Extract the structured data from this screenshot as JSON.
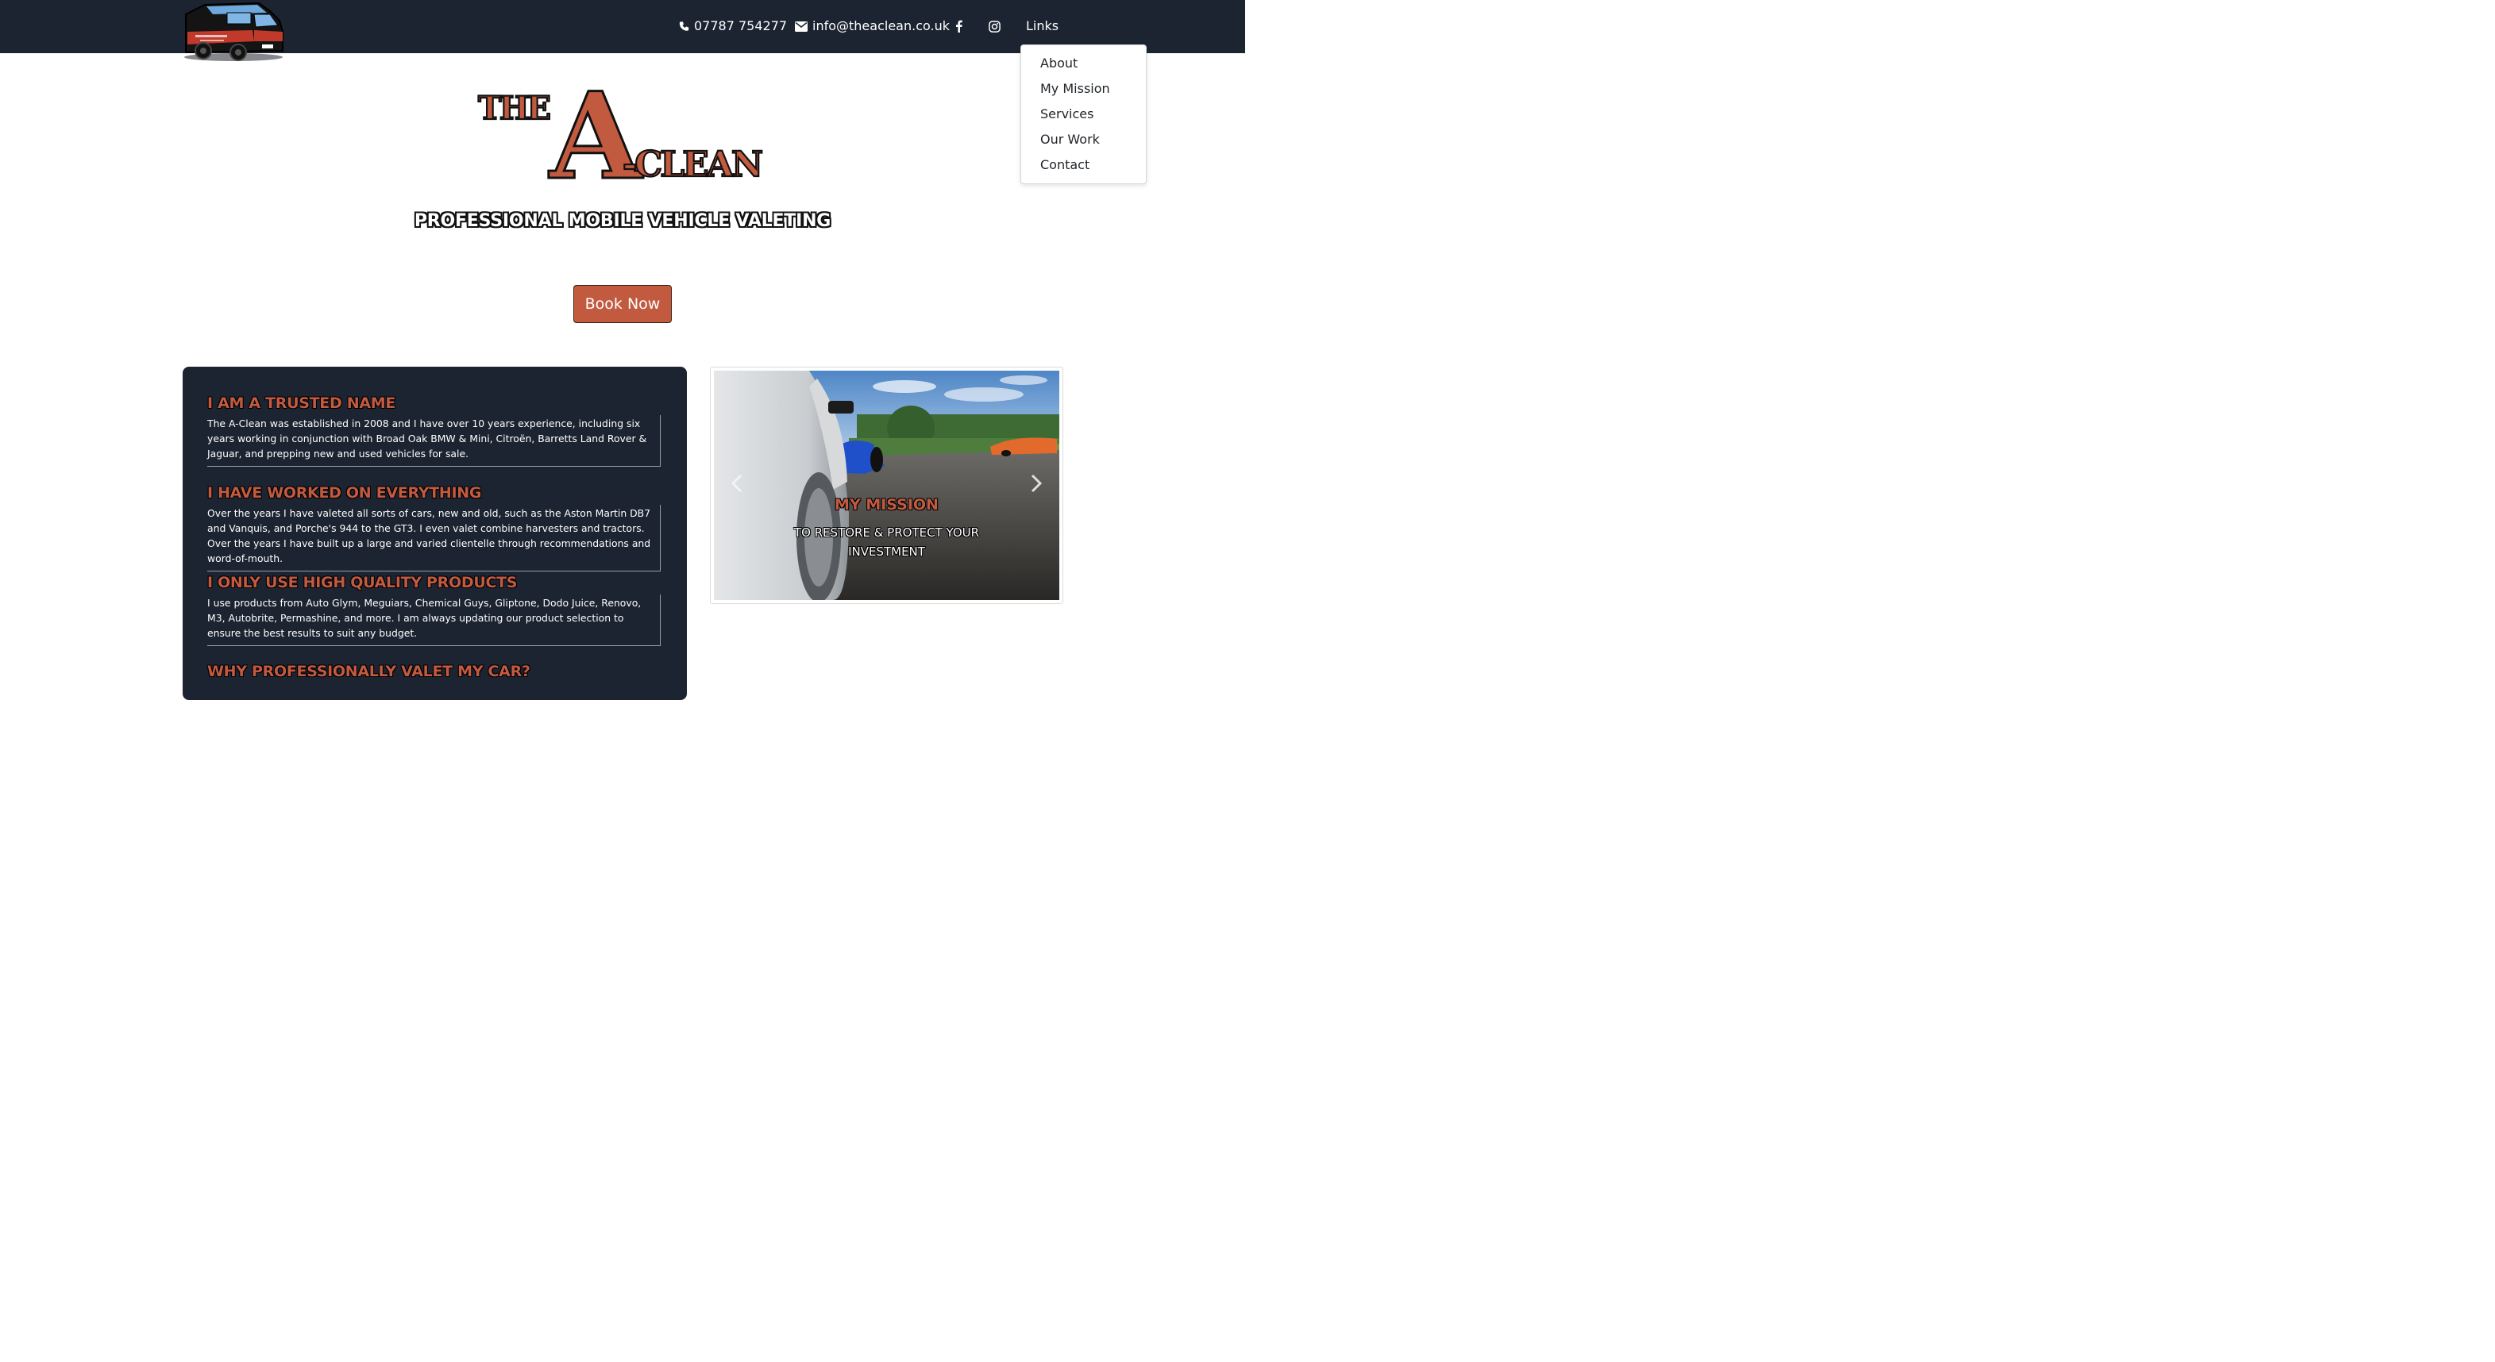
{
  "nav": {
    "phone": "07787 754277",
    "email": "info@theaclean.co.uk",
    "links_label": "Links",
    "icons": {
      "phone": "phone-icon",
      "email": "envelope-icon",
      "facebook": "facebook-icon",
      "instagram": "instagram-icon"
    }
  },
  "dropdown": {
    "items": [
      {
        "label": "About"
      },
      {
        "label": "My Mission"
      },
      {
        "label": "Services"
      },
      {
        "label": "Our Work"
      },
      {
        "label": "Contact"
      }
    ]
  },
  "logo": {
    "text_small": "THE",
    "text_big": "A",
    "text_rest": "-CLEAN"
  },
  "hero": {
    "tagline": "PROFESSIONAL MOBILE VEHICLE VALETING",
    "book_label": "Book Now"
  },
  "about": {
    "sections": [
      {
        "title": "I AM A TRUSTED NAME",
        "body": "The A-Clean was established in 2008 and I have over 10 years experience, including six years working in conjunction with Broad Oak BMW & Mini, Citroën, Barretts Land Rover & Jaguar, and prepping new and used vehicles for sale."
      },
      {
        "title": "I HAVE WORKED ON EVERYTHING",
        "body": "Over the years I have valeted all sorts of cars, new and old, such as the Aston Martin DB7 and Vanquis, and Porche's 944 to the GT3. I even valet combine harvesters and tractors. Over the years I have built up a large and varied clientelle through recommendations and word-of-mouth."
      },
      {
        "title": "I ONLY USE HIGH QUALITY PRODUCTS",
        "body": "I use products from Auto Glym, Meguiars, Chemical Guys, Gliptone, Dodo Juice, Renovo, M3, Autobrite, Permashine, and more. I am always updating our product selection to ensure the best results to suit any budget."
      },
      {
        "title": "WHY PROFESSIONALLY VALET MY CAR?",
        "body": ""
      }
    ]
  },
  "carousel": {
    "title": "MY MISSION",
    "text": "TO RESTORE & PROTECT YOUR INVESTMENT"
  },
  "colors": {
    "navbar": "#1c2331",
    "accent": "#c25a40",
    "card": "#1c2331"
  }
}
